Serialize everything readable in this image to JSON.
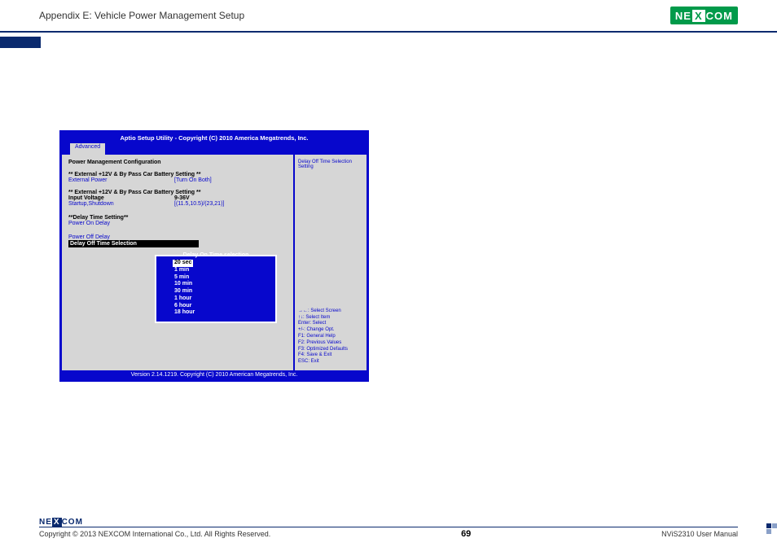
{
  "header": {
    "appendix": "Appendix E: Vehicle Power Management Setup",
    "logoText": "NEXCOM"
  },
  "bios": {
    "title": "Aptio Setup Utility - Copyright (C) 2010 America Megatrends, Inc.",
    "tabActive": "Advanced",
    "footer": "Version 2.14.1219. Copyright (C) 2010 American Megatrends, Inc.",
    "left": {
      "heading": "Power Management Configuration",
      "group1Title": "** External +12V & By Pass Car Battery Setting **",
      "extPowerLabel": "External Power",
      "extPowerValue": "[Turn On Both]",
      "group2Title": "** External +12V & By Pass Car Battery Setting **",
      "inputVoltageLabel": "Input Voltage",
      "inputVoltageValue": "9-36V",
      "startupLabel": "Startup,Shutdown",
      "startupValue": "[(11.5,10.5)/(23,21)]",
      "delayHeading": "**Delay Time Setting**",
      "powerOnDelayLabel": "Power On Delay",
      "powerOffDelayLabel": "Power Off Delay",
      "delayOffSelLabel": "Delay Off Time Selection"
    },
    "right": {
      "topLabel": "Delay Off Time Selection Setting",
      "keys": [
        "→←: Select Screen",
        "↑↓: Select Item",
        "Enter: Select",
        "+/-: Change Opt.",
        "F1: General Help",
        "F2: Previous Values",
        "F3: Optimized Defaults",
        "F4: Save & Exit",
        "ESC: Exit"
      ]
    },
    "popup": {
      "title": "Delay On Time selection",
      "options": [
        "20 sec",
        "1 min",
        "5 min",
        "10 min",
        "30 min",
        "1 hour",
        "6 hour",
        "18 hour"
      ],
      "selectedIndex": 0
    }
  },
  "footer": {
    "copyright": "Copyright © 2013 NEXCOM International Co., Ltd. All Rights Reserved.",
    "pageNumber": "69",
    "manual": "NViS2310 User Manual"
  }
}
